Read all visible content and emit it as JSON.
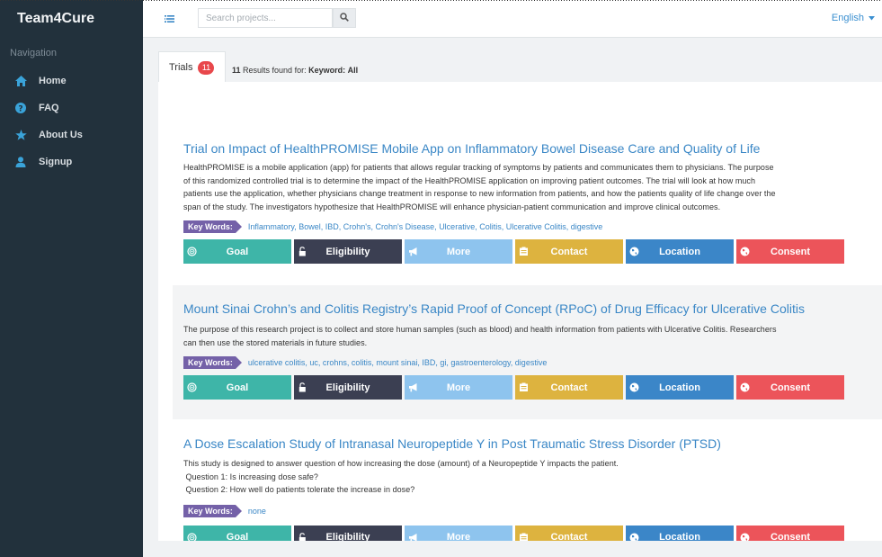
{
  "app": {
    "brand": "Team4Cure"
  },
  "sidebar": {
    "nav_title": "Navigation",
    "items": [
      {
        "label": "Home",
        "icon": "home-icon"
      },
      {
        "label": "FAQ",
        "icon": "question-icon"
      },
      {
        "label": "About Us",
        "icon": "star-icon"
      },
      {
        "label": "Signup",
        "icon": "user-icon"
      }
    ]
  },
  "header": {
    "search_placeholder": "Search projects...",
    "language": "English"
  },
  "tabs": {
    "trials_label": "Trials",
    "trials_count": "11"
  },
  "results": {
    "count": "11",
    "found_for": "Results found for:",
    "keyword_label": "Keyword:",
    "keyword_value": "All"
  },
  "keywords_label": "Key Words:",
  "buttons": {
    "goal": "Goal",
    "eligibility": "Eligibility",
    "more": "More",
    "contact": "Contact",
    "location": "Location",
    "consent": "Consent"
  },
  "colors": {
    "goal": "#3eb5a8",
    "eligibility": "#3b3f52",
    "more": "#8ec4ee",
    "contact": "#ddb33f",
    "location": "#3b86c8",
    "consent": "#ec545a"
  },
  "trials": [
    {
      "title": "Trial on Impact of HealthPROMISE Mobile App on Inflammatory Bowel Disease Care and Quality of Life",
      "description": [
        "HealthPROMISE is a mobile application (app) for patients that allows regular tracking of symptoms by patients and communicates them to physicians. The purpose",
        "of this randomized controlled trial is to determine the impact of the HealthPROMISE application on improving patient outcomes. The trial will look at how much",
        "patients use the application, whether physicians change treatment in response to new information from patients, and how the patients quality of life change over the",
        "span of the study. The investigators hypothesize that HealthPROMISE will enhance physician-patient communication and improve clinical outcomes."
      ],
      "keywords": "Inflammatory, Bowel, IBD, Crohn's, Crohn's Disease, Ulcerative, Colitis, Ulcerative Colitis, digestive"
    },
    {
      "title": "Mount Sinai Crohn’s and Colitis Registry’s Rapid Proof of Concept (RPoC) of Drug Efficacy for Ulcerative Colitis",
      "description": [
        "The purpose of this research project is to collect and store human samples (such as blood) and health information from patients with Ulcerative Colitis. Researchers",
        "can then use the stored materials in future studies."
      ],
      "keywords": "ulcerative colitis, uc, crohns, colitis, mount sinai, IBD, gi, gastroenterology, digestive"
    },
    {
      "title": "A Dose Escalation Study of Intranasal Neuropeptide Y in Post Traumatic Stress Disorder (PTSD)",
      "description": [
        "This study is designed to answer question of how increasing the dose (amount) of a Neuropeptide Y impacts the patient.",
        " Question 1: Is increasing dose safe?",
        " Question 2: How well do patients tolerate the increase in dose?"
      ],
      "keywords": "none"
    }
  ]
}
